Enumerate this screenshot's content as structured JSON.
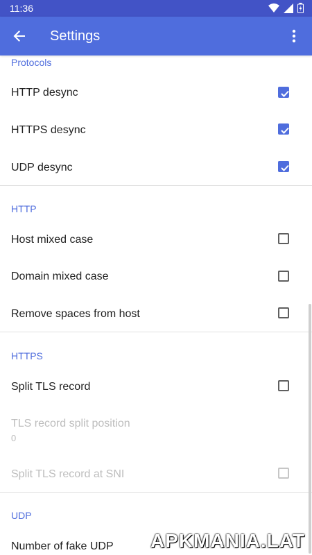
{
  "status_bar": {
    "time": "11:36"
  },
  "appbar": {
    "title": "Settings"
  },
  "sections": {
    "protocols": "Protocols",
    "http": "HTTP",
    "https": "HTTPS",
    "udp": "UDP"
  },
  "settings": {
    "http_desync": {
      "label": "HTTP desync",
      "checked": true
    },
    "https_desync": {
      "label": "HTTPS desync",
      "checked": true
    },
    "udp_desync": {
      "label": "UDP desync",
      "checked": true
    },
    "host_mixed_case": {
      "label": "Host mixed case",
      "checked": false
    },
    "domain_mixed_case": {
      "label": "Domain mixed case",
      "checked": false
    },
    "remove_spaces": {
      "label": "Remove spaces from host",
      "checked": false
    },
    "split_tls": {
      "label": "Split TLS record",
      "checked": false
    },
    "tls_split_position": {
      "label": "TLS record split position",
      "value": "0"
    },
    "split_tls_sni": {
      "label": "Split TLS record at SNI",
      "checked": false
    },
    "fake_udp": {
      "label": "Number of fake UDP"
    }
  },
  "watermark": "APKMANIA.LAT",
  "colors": {
    "accent": "#4f6ddd",
    "status_bar": "#4253c6"
  }
}
